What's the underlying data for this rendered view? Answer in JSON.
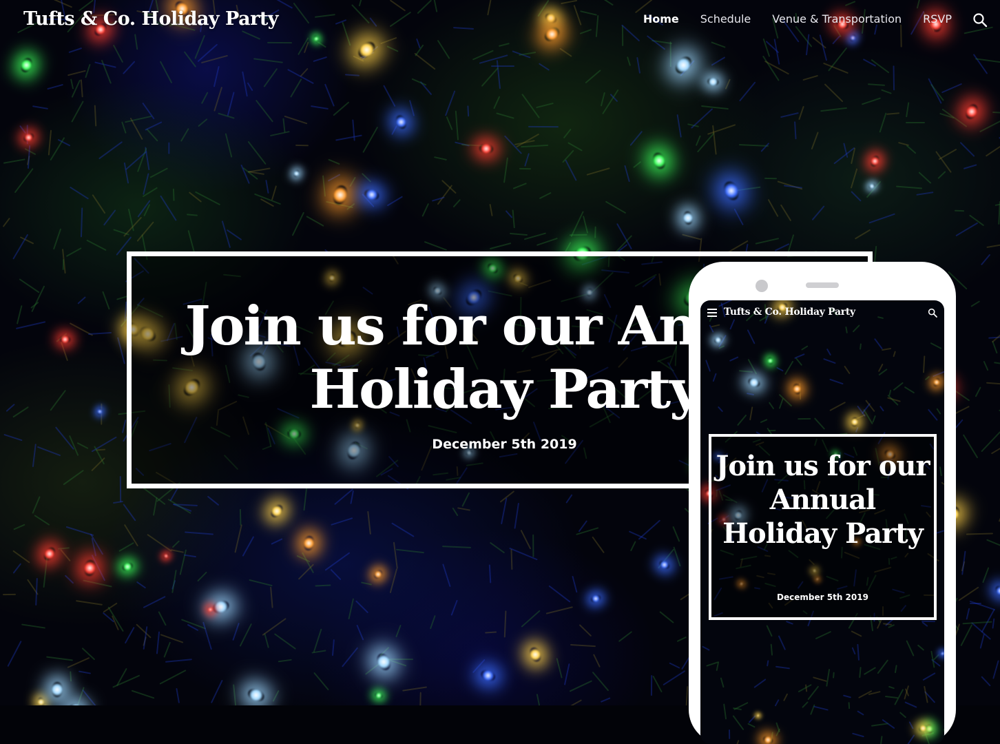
{
  "site": {
    "title": "Tufts & Co. Holiday Party"
  },
  "nav": {
    "items": [
      {
        "label": "Home",
        "active": true
      },
      {
        "label": "Schedule",
        "active": false
      },
      {
        "label": "Venue & Transportation",
        "active": false
      },
      {
        "label": "RSVP",
        "active": false
      }
    ],
    "search_icon": "search-icon"
  },
  "hero": {
    "line1": "Join us for our Annual",
    "line2": "Holiday Party",
    "date": "December 5th 2019"
  },
  "mobile": {
    "site_title": "Tufts & Co. Holiday Party",
    "menu_icon": "hamburger-menu-icon",
    "search_icon": "search-icon",
    "heading": "Join us for our Annual Holiday Party",
    "date": "December 5th 2019"
  },
  "colors": {
    "text": "#ffffff",
    "frame": "#ffffff",
    "background": "#03040c"
  }
}
